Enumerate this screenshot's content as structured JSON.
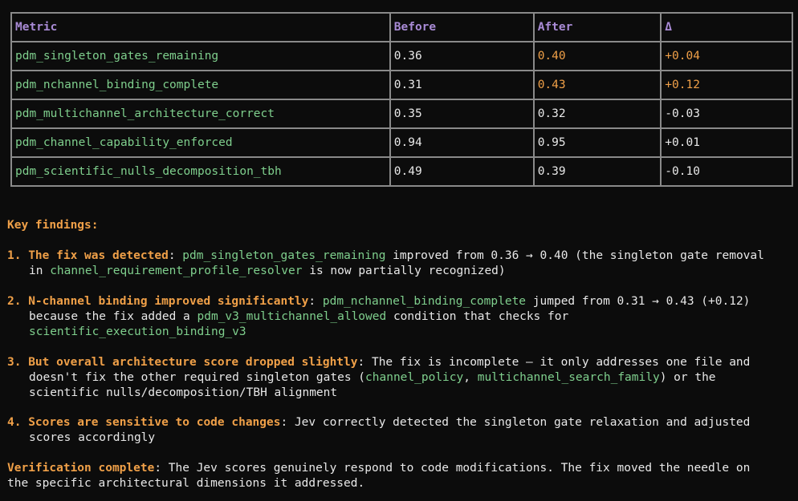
{
  "table": {
    "headers": [
      "Metric",
      "Before",
      "After",
      "Δ"
    ],
    "rows": [
      {
        "metric": "pdm_singleton_gates_remaining",
        "before": "0.36",
        "after": "0.40",
        "delta": "+0.04",
        "highlight": true
      },
      {
        "metric": "pdm_nchannel_binding_complete",
        "before": "0.31",
        "after": "0.43",
        "delta": "+0.12",
        "highlight": true
      },
      {
        "metric": "pdm_multichannel_architecture_correct",
        "before": "0.35",
        "after": "0.32",
        "delta": "-0.03",
        "highlight": false
      },
      {
        "metric": "pdm_channel_capability_enforced",
        "before": "0.94",
        "after": "0.95",
        "delta": "+0.01",
        "highlight": false
      },
      {
        "metric": "pdm_scientific_nulls_decomposition_tbh",
        "before": "0.49",
        "after": "0.39",
        "delta": "-0.10",
        "highlight": false
      }
    ]
  },
  "findings": {
    "title": "Key findings:",
    "items": [
      {
        "num": "1.",
        "bold": "The fix was detected",
        "l1_a": ": ",
        "l1_code": "pdm_singleton_gates_remaining",
        "l1_b": " improved from 0.36 → 0.40 (the singleton gate removal",
        "l2_a": "in ",
        "l2_code": "channel_requirement_profile_resolver",
        "l2_b": " is now partially recognized)"
      },
      {
        "num": "2.",
        "bold": "N-channel binding improved significantly",
        "l1_a": ": ",
        "l1_code": "pdm_nchannel_binding_complete",
        "l1_b": " jumped from 0.31 → 0.43 (+0.12)",
        "l2_a": "because the fix added a ",
        "l2_code": "pdm_v3_multichannel_allowed",
        "l2_b": " condition that checks for",
        "l3_code": "scientific_execution_binding_v3"
      },
      {
        "num": "3.",
        "bold": "But overall architecture score dropped slightly",
        "l1_b": ": The fix is incomplete — it only addresses one file and",
        "l2_a": "doesn't fix the other required singleton gates (",
        "l2_code": "channel_policy",
        "l2_mid": ", ",
        "l2_code2": "multichannel_search_family",
        "l2_b": ") or the",
        "l3_a": "scientific nulls/decomposition/TBH alignment"
      },
      {
        "num": "4.",
        "bold": "Scores are sensitive to code changes",
        "l1_b": ": Jev correctly detected the singleton gate relaxation and adjusted",
        "l2_a": "scores accordingly"
      }
    ]
  },
  "verification": {
    "bold": "Verification complete",
    "l1": ": The Jev scores genuinely respond to code modifications. The fix moved the needle on",
    "l2": "the specific architectural dimensions it addressed."
  }
}
